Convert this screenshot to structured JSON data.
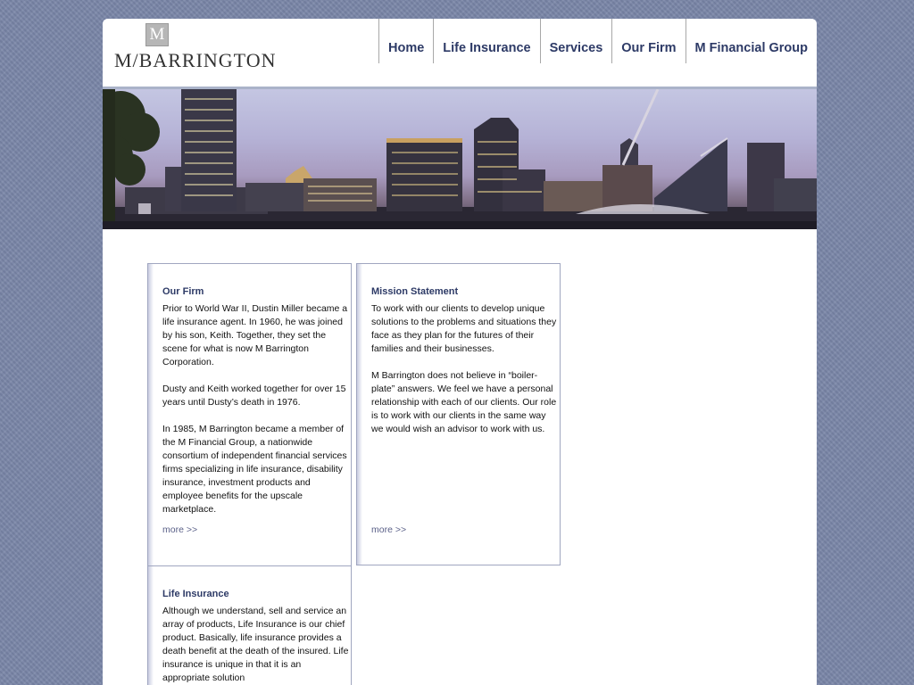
{
  "logo": {
    "monogram": "M",
    "name": "M/BARRINGTON"
  },
  "nav": {
    "items": [
      "Home",
      "Life Insurance",
      "Services",
      "Our Firm",
      "M Financial Group"
    ]
  },
  "panels": {
    "our_firm": {
      "title": "Our Firm",
      "paragraphs": [
        "Prior to World War II, Dustin Miller became a life insurance agent. In 1960, he was joined by his son, Keith. Together, they set the scene for what is now M Barrington Corporation.",
        "Dusty and Keith worked together for over 15 years until Dusty’s death in 1976.",
        "In 1985, M Barrington became a member of the M Financial Group, a nationwide consortium of independent financial services firms specializing in life insurance, disability insurance, investment products and employee benefits for the upscale marketplace."
      ],
      "more": "more >>"
    },
    "mission": {
      "title": "Mission Statement",
      "paragraphs": [
        "To work with our clients to develop unique solutions to the problems and situations they face as they plan for the futures of their families and their businesses.",
        "M Barrington does not believe in “boiler-plate” answers. We feel we have a personal relationship with each of our clients. Our role is to work with our clients in the same way we would wish an advisor to work with us."
      ],
      "more": "more >>"
    },
    "life_insurance": {
      "title": "Life Insurance",
      "paragraphs": [
        "Although we understand, sell and service an array of products, Life Insurance is our chief product. Basically, life insurance provides a death benefit at the death of the insured. Life insurance is unique in that it is an appropriate solution"
      ]
    }
  }
}
